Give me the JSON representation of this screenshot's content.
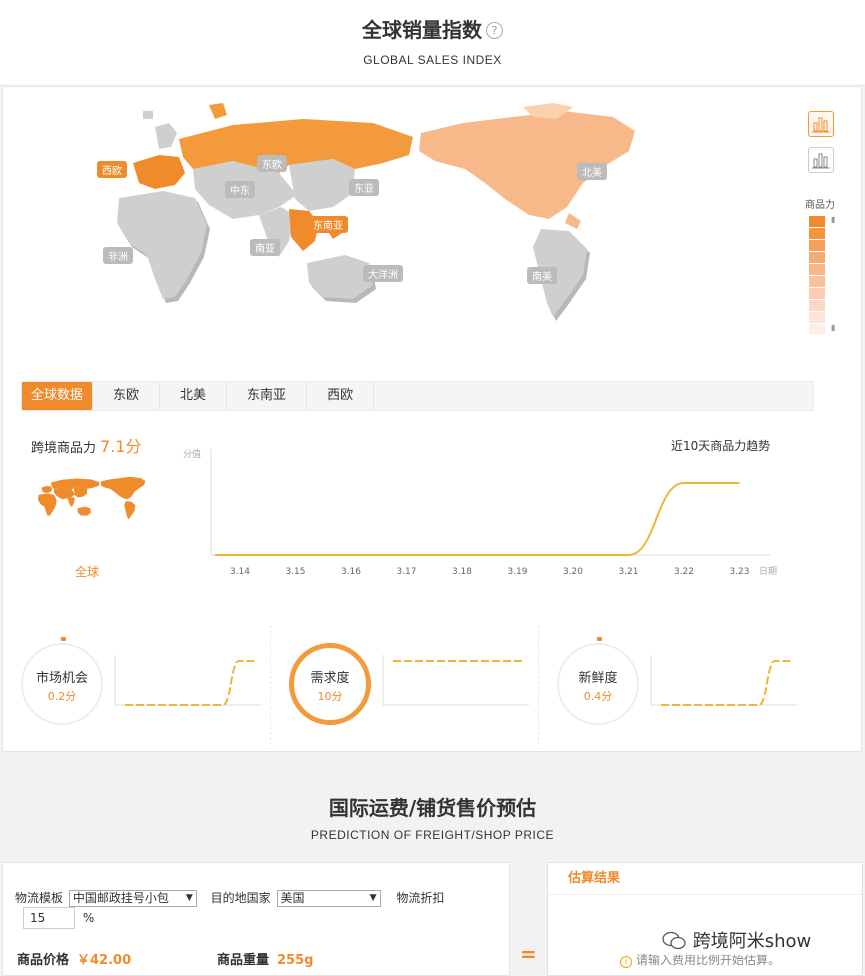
{
  "header": {
    "title": "全球销量指数",
    "subtitle": "GLOBAL SALES INDEX",
    "help_icon": "?"
  },
  "map": {
    "tags": [
      "西欧",
      "东欧",
      "中东",
      "东亚",
      "北美",
      "东南亚",
      "非洲",
      "南亚",
      "大洋洲",
      "南美"
    ],
    "legend_title": "商品力",
    "colors": {
      "active": "#f08b2c",
      "light": "#f7b98a",
      "lighter": "#fbd0ad",
      "inactive": "#cfcfcf"
    }
  },
  "tabs": [
    "全球数据",
    "东欧",
    "北美",
    "东南亚",
    "西欧"
  ],
  "summary": {
    "label": "跨境商品力",
    "score": "7.1分",
    "region": "全球"
  },
  "trend": {
    "title": "近10天商品力趋势"
  },
  "chart_data": {
    "type": "line",
    "title": "近10天商品力趋势",
    "ylabel": "分值",
    "xlabel": "日期",
    "x": [
      "3.14",
      "3.15",
      "3.16",
      "3.17",
      "3.18",
      "3.19",
      "3.20",
      "3.21",
      "3.22",
      "3.23"
    ],
    "series": [
      {
        "values": [
          0,
          0,
          0,
          0,
          0,
          0,
          0,
          0,
          7.1,
          7.1
        ]
      }
    ],
    "grid": false
  },
  "metrics": [
    {
      "name": "市场机会",
      "value": "0.2分",
      "highlight": false
    },
    {
      "name": "需求度",
      "value": "10分",
      "highlight": true
    },
    {
      "name": "新鲜度",
      "value": "0.4分",
      "highlight": false
    }
  ],
  "freight": {
    "title": "国际运费/铺货售价预估",
    "subtitle": "PREDICTION OF FREIGHT/SHOP PRICE",
    "logistics_label": "物流模板",
    "logistics_value": "中国邮政挂号小包",
    "country_label": "目的地国家",
    "country_value": "美国",
    "discount_label": "物流折扣",
    "discount_value": "15",
    "discount_unit": "%",
    "price_label": "商品价格",
    "price_value": "￥42.00",
    "weight_label": "商品重量",
    "weight_value": "255g",
    "equals": "=",
    "result_title": "估算结果",
    "result_hint": "请输入费用比例开始估算。"
  },
  "watermark": "跨境阿米show"
}
